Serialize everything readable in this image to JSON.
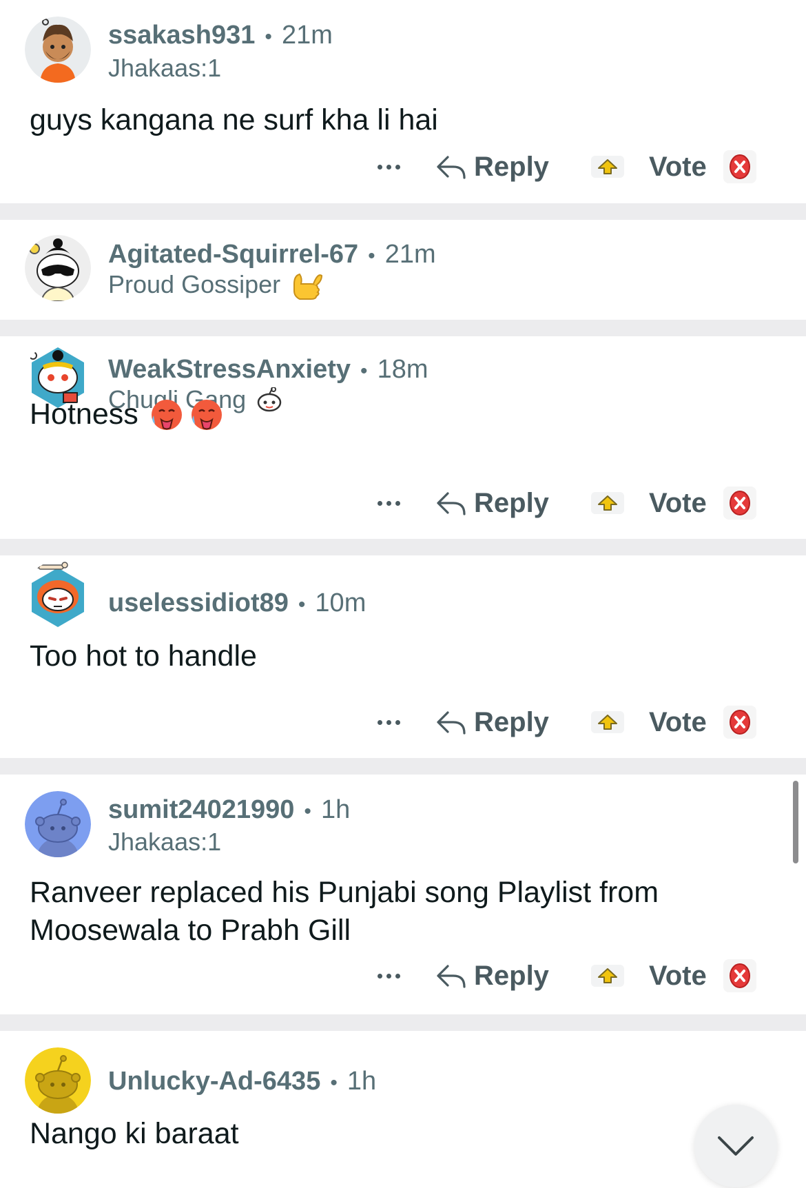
{
  "comments": [
    {
      "username": "ssakash931",
      "separator": "•",
      "time": "21m",
      "flair": "Jhakaas:1",
      "text": "guys kangana ne surf kha li hai",
      "avatar": "snoo-orange-turban-avatar"
    },
    {
      "username": "Agitated-Squirrel-67",
      "separator": "•",
      "time": "21m",
      "flair": "Proud Gossiper",
      "flair_emoji": "call-me-hand-icon",
      "avatar": "snoo-sunglasses-avatar"
    },
    {
      "username": "WeakStressAnxiety",
      "separator": "•",
      "time": "18m",
      "flair": "Chugli Gang",
      "flair_emoji": "snoo-face-icon",
      "text": "Hotness",
      "text_emojis": [
        "hot-face-icon",
        "hot-face-icon"
      ],
      "avatar": "snoo-hex-avatar"
    },
    {
      "username": "uselessidiot89",
      "separator": "•",
      "time": "10m",
      "text": "Too hot to handle",
      "avatar": "snoo-bone-hex-avatar"
    },
    {
      "username": "sumit24021990",
      "separator": "•",
      "time": "1h",
      "flair": "Jhakaas:1",
      "text": "Ranveer replaced his Punjabi song Playlist from Moosewala to Prabh Gill",
      "avatar": "default-snoo-blue-avatar"
    },
    {
      "username": "Unlucky-Ad-6435",
      "separator": "•",
      "time": "1h",
      "text": "Nango ki baraat",
      "avatar": "default-snoo-yellow-avatar"
    }
  ],
  "actions": {
    "reply_label": "Reply",
    "vote_label": "Vote"
  },
  "colors": {
    "meta_text": "#576f76",
    "body_text": "#0f1a1c",
    "background": "#ececee",
    "card": "#ffffff"
  }
}
